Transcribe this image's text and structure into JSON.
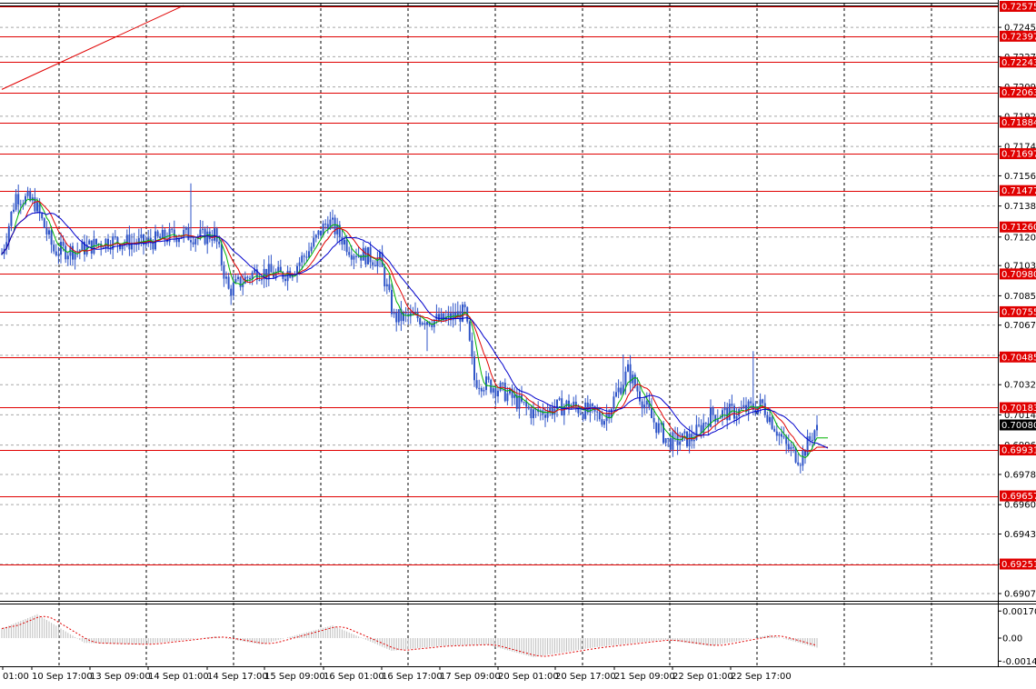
{
  "chart_data": {
    "type": "candlestick",
    "symbol": "",
    "colors": {
      "candle": "#2f55c8",
      "ma_fast": "#00b400",
      "ma_mid": "#e00000",
      "ma_slow": "#0000cc",
      "level_line": "#e00000",
      "level_tag_bg": "#e00000",
      "current_tag_bg": "#000000",
      "osc_hist": "#bdbdbd",
      "osc_signal": "#e00000",
      "grid": "#000000"
    },
    "price_axis": {
      "ylim": [
        0.69,
        0.726
      ],
      "ticks": [
        "0.72450",
        "0.72275",
        "0.72095",
        "0.71920",
        "0.71740",
        "0.71565",
        "0.71385",
        "0.71200",
        "0.71030",
        "0.70850",
        "0.70675",
        "0.70495",
        "0.70320",
        "0.70140",
        "0.69960",
        "0.69785",
        "0.69605",
        "0.69430",
        "0.69250",
        "0.69075"
      ]
    },
    "levels": [
      {
        "value": 0.72575,
        "label": "0.72575"
      },
      {
        "value": 0.72397,
        "label": "0.72397"
      },
      {
        "value": 0.72243,
        "label": "0.72243"
      },
      {
        "value": 0.72063,
        "label": "0.72063"
      },
      {
        "value": 0.71884,
        "label": "0.71884"
      },
      {
        "value": 0.71697,
        "label": "0.71697"
      },
      {
        "value": 0.71477,
        "label": "0.71477"
      },
      {
        "value": 0.7126,
        "label": "0.71260"
      },
      {
        "value": 0.7098,
        "label": "0.70980"
      },
      {
        "value": 0.70755,
        "label": "0.70755"
      },
      {
        "value": 0.70485,
        "label": "0.70485"
      },
      {
        "value": 0.70183,
        "label": "0.70183"
      },
      {
        "value": 0.69931,
        "label": "0.69931"
      },
      {
        "value": 0.69657,
        "label": "0.69657"
      },
      {
        "value": 0.69251,
        "label": "0.69251"
      }
    ],
    "current_price": {
      "value": 0.7008,
      "label": "0.70080"
    },
    "trendline": {
      "from": {
        "bar": 0,
        "price": 0.7208
      },
      "to": {
        "bar": 77,
        "price": 0.7258
      }
    },
    "time_axis": [
      "01:00",
      "10 Sep 17:00",
      "13 Sep 09:00",
      "14 Sep 01:00",
      "14 Sep 17:00",
      "15 Sep 09:00",
      "16 Sep 01:00",
      "16 Sep 17:00",
      "17 Sep 09:00",
      "20 Sep 01:00",
      "20 Sep 17:00",
      "21 Sep 09:00",
      "22 Sep 01:00",
      "22 Sep 17:00"
    ],
    "time_keypoints": [
      {
        "bar": 0,
        "price": 0.711
      },
      {
        "bar": 6,
        "price": 0.7145
      },
      {
        "bar": 14,
        "price": 0.714
      },
      {
        "bar": 22,
        "price": 0.7112
      },
      {
        "bar": 32,
        "price": 0.7112
      },
      {
        "bar": 45,
        "price": 0.7118
      },
      {
        "bar": 60,
        "price": 0.7116
      },
      {
        "bar": 75,
        "price": 0.7122
      },
      {
        "bar": 85,
        "price": 0.712
      },
      {
        "bar": 90,
        "price": 0.7122
      },
      {
        "bar": 96,
        "price": 0.7088
      },
      {
        "bar": 108,
        "price": 0.71
      },
      {
        "bar": 118,
        "price": 0.7097
      },
      {
        "bar": 124,
        "price": 0.7102
      },
      {
        "bar": 130,
        "price": 0.7112
      },
      {
        "bar": 138,
        "price": 0.713
      },
      {
        "bar": 148,
        "price": 0.7112
      },
      {
        "bar": 160,
        "price": 0.7106
      },
      {
        "bar": 166,
        "price": 0.7072
      },
      {
        "bar": 176,
        "price": 0.7072
      },
      {
        "bar": 186,
        "price": 0.707
      },
      {
        "bar": 196,
        "price": 0.7075
      },
      {
        "bar": 200,
        "price": 0.7035
      },
      {
        "bar": 210,
        "price": 0.703
      },
      {
        "bar": 225,
        "price": 0.7015
      },
      {
        "bar": 240,
        "price": 0.702
      },
      {
        "bar": 255,
        "price": 0.7012
      },
      {
        "bar": 265,
        "price": 0.704
      },
      {
        "bar": 275,
        "price": 0.7012
      },
      {
        "bar": 282,
        "price": 0.6998
      },
      {
        "bar": 292,
        "price": 0.7
      },
      {
        "bar": 300,
        "price": 0.7014
      },
      {
        "bar": 312,
        "price": 0.7016
      },
      {
        "bar": 322,
        "price": 0.702
      },
      {
        "bar": 332,
        "price": 0.6995
      },
      {
        "bar": 338,
        "price": 0.6988
      },
      {
        "bar": 344,
        "price": 0.7005
      }
    ],
    "osc_axis": {
      "ticks": [
        "0.001709",
        "0.00",
        "-0.00145"
      ]
    },
    "osc_keypoints": [
      {
        "bar": 0,
        "value": 0.0006
      },
      {
        "bar": 15,
        "value": 0.0015
      },
      {
        "bar": 35,
        "value": -0.0003
      },
      {
        "bar": 60,
        "value": -0.0004
      },
      {
        "bar": 90,
        "value": 0.0001
      },
      {
        "bar": 110,
        "value": -0.0004
      },
      {
        "bar": 140,
        "value": 0.0008
      },
      {
        "bar": 165,
        "value": -0.0008
      },
      {
        "bar": 185,
        "value": -0.0005
      },
      {
        "bar": 205,
        "value": -0.0004
      },
      {
        "bar": 225,
        "value": -0.0012
      },
      {
        "bar": 250,
        "value": -0.0006
      },
      {
        "bar": 280,
        "value": -0.0001
      },
      {
        "bar": 300,
        "value": -0.0005
      },
      {
        "bar": 325,
        "value": 0.0002
      },
      {
        "bar": 345,
        "value": -0.0006
      }
    ]
  }
}
